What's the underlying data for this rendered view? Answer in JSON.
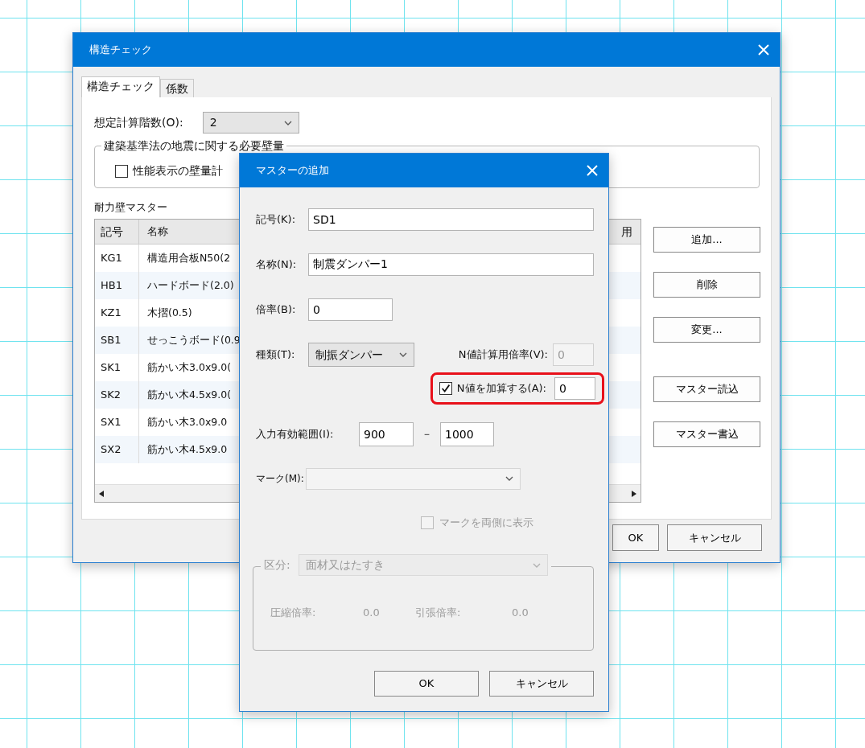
{
  "background_window": {
    "title": "構造チェック",
    "tabs": [
      {
        "label": "構造チェック",
        "selected": true
      },
      {
        "label": "係数",
        "selected": false
      }
    ],
    "floor_count": {
      "label": "想定計算階数(O):",
      "value": "2"
    },
    "wall_group": {
      "legend": "建築基準法の地震に関する必要壁量",
      "checkbox": {
        "label": "性能表示の壁量計",
        "checked": false
      }
    },
    "table": {
      "title": "耐力壁マスター",
      "columns": [
        "記号",
        "名称",
        "用"
      ],
      "rows": [
        {
          "cells": [
            "KG1",
            "構造用合板N50(2"
          ]
        },
        {
          "cells": [
            "HB1",
            "ハードボード(2.0)"
          ]
        },
        {
          "cells": [
            "KZ1",
            "木摺(0.5)"
          ]
        },
        {
          "cells": [
            "SB1",
            "せっこうボード(0.9"
          ]
        },
        {
          "cells": [
            "SK1",
            "筋かい木3.0x9.0("
          ]
        },
        {
          "cells": [
            "SK2",
            "筋かい木4.5x9.0("
          ]
        },
        {
          "cells": [
            "SX1",
            "筋かい木3.0x9.0"
          ]
        },
        {
          "cells": [
            "SX2",
            "筋かい木4.5x9.0"
          ]
        }
      ]
    },
    "side_buttons": [
      "追加...",
      "削除",
      "変更...",
      "マスター読込",
      "マスター書込"
    ],
    "buttons": [
      "OK",
      "キャンセル"
    ]
  },
  "dialog": {
    "title": "マスターの追加",
    "symbol": {
      "label": "記号(K):",
      "value": "SD1"
    },
    "name": {
      "label": "名称(N):",
      "value": "制震ダンパー1"
    },
    "ratio": {
      "label": "倍率(B):",
      "value": "0"
    },
    "type": {
      "label": "種類(T):",
      "value": "制振ダンパー"
    },
    "n_ratio": {
      "label": "N値計算用倍率(V):",
      "value": "0",
      "disabled": true
    },
    "add_n": {
      "label": "N値を加算する(A):",
      "checked": true,
      "value": "0",
      "highlighted": true
    },
    "range": {
      "label": "入力有効範囲(I):",
      "from": "900",
      "separator": "－",
      "to": "1000"
    },
    "mark": {
      "label": "マーク(M):",
      "disabled": true
    },
    "both_sides": {
      "label": "マークを両側に表示",
      "checked": false,
      "disabled": true
    },
    "category": {
      "legend": "区分:",
      "value": "面材又はたすき",
      "disabled": true,
      "compression_label": "圧縮倍率:",
      "compression": "0.0",
      "tension_label": "引張倍率:",
      "tension": "0.0"
    },
    "buttons": [
      "OK",
      "キャンセル"
    ]
  }
}
